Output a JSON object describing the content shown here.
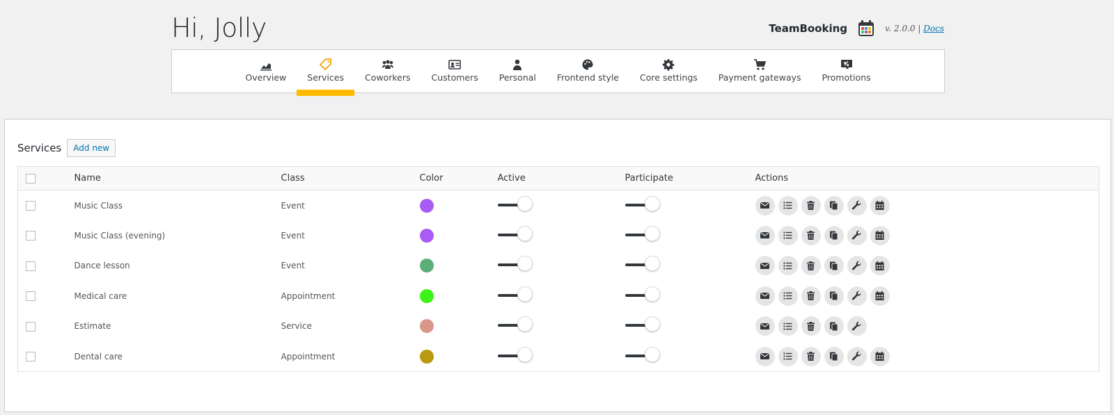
{
  "greeting": "Hi, Jolly",
  "brand": {
    "name": "TeamBooking",
    "version": "v. 2.0.0",
    "separator": "|",
    "docs": "Docs"
  },
  "nav": [
    {
      "label": "Overview",
      "icon": "chart-icon"
    },
    {
      "label": "Services",
      "icon": "tag-icon",
      "active": true
    },
    {
      "label": "Coworkers",
      "icon": "group-icon"
    },
    {
      "label": "Customers",
      "icon": "id-card-icon"
    },
    {
      "label": "Personal",
      "icon": "person-icon"
    },
    {
      "label": "Frontend style",
      "icon": "palette-icon"
    },
    {
      "label": "Core settings",
      "icon": "gear-icon"
    },
    {
      "label": "Payment gateways",
      "icon": "cart-icon"
    },
    {
      "label": "Promotions",
      "icon": "promo-icon"
    }
  ],
  "panel": {
    "title": "Services",
    "add_label": "Add new"
  },
  "table": {
    "headers": {
      "name": "Name",
      "class": "Class",
      "color": "Color",
      "active": "Active",
      "participate": "Participate",
      "actions": "Actions"
    },
    "rows": [
      {
        "name": "Music Class",
        "class": "Event",
        "color": "#a95cf3",
        "active": true,
        "participate": true,
        "calendar": true
      },
      {
        "name": "Music Class (evening)",
        "class": "Event",
        "color": "#a95cf3",
        "active": true,
        "participate": true,
        "calendar": true
      },
      {
        "name": "Dance lesson",
        "class": "Event",
        "color": "#5dad7a",
        "active": true,
        "participate": true,
        "calendar": true
      },
      {
        "name": "Medical care",
        "class": "Appointment",
        "color": "#3df318",
        "active": true,
        "participate": true,
        "calendar": true
      },
      {
        "name": "Estimate",
        "class": "Service",
        "color": "#d9978a",
        "active": true,
        "participate": true,
        "calendar": false
      },
      {
        "name": "Dental care",
        "class": "Appointment",
        "color": "#b9990f",
        "active": true,
        "participate": true,
        "calendar": true
      }
    ]
  }
}
